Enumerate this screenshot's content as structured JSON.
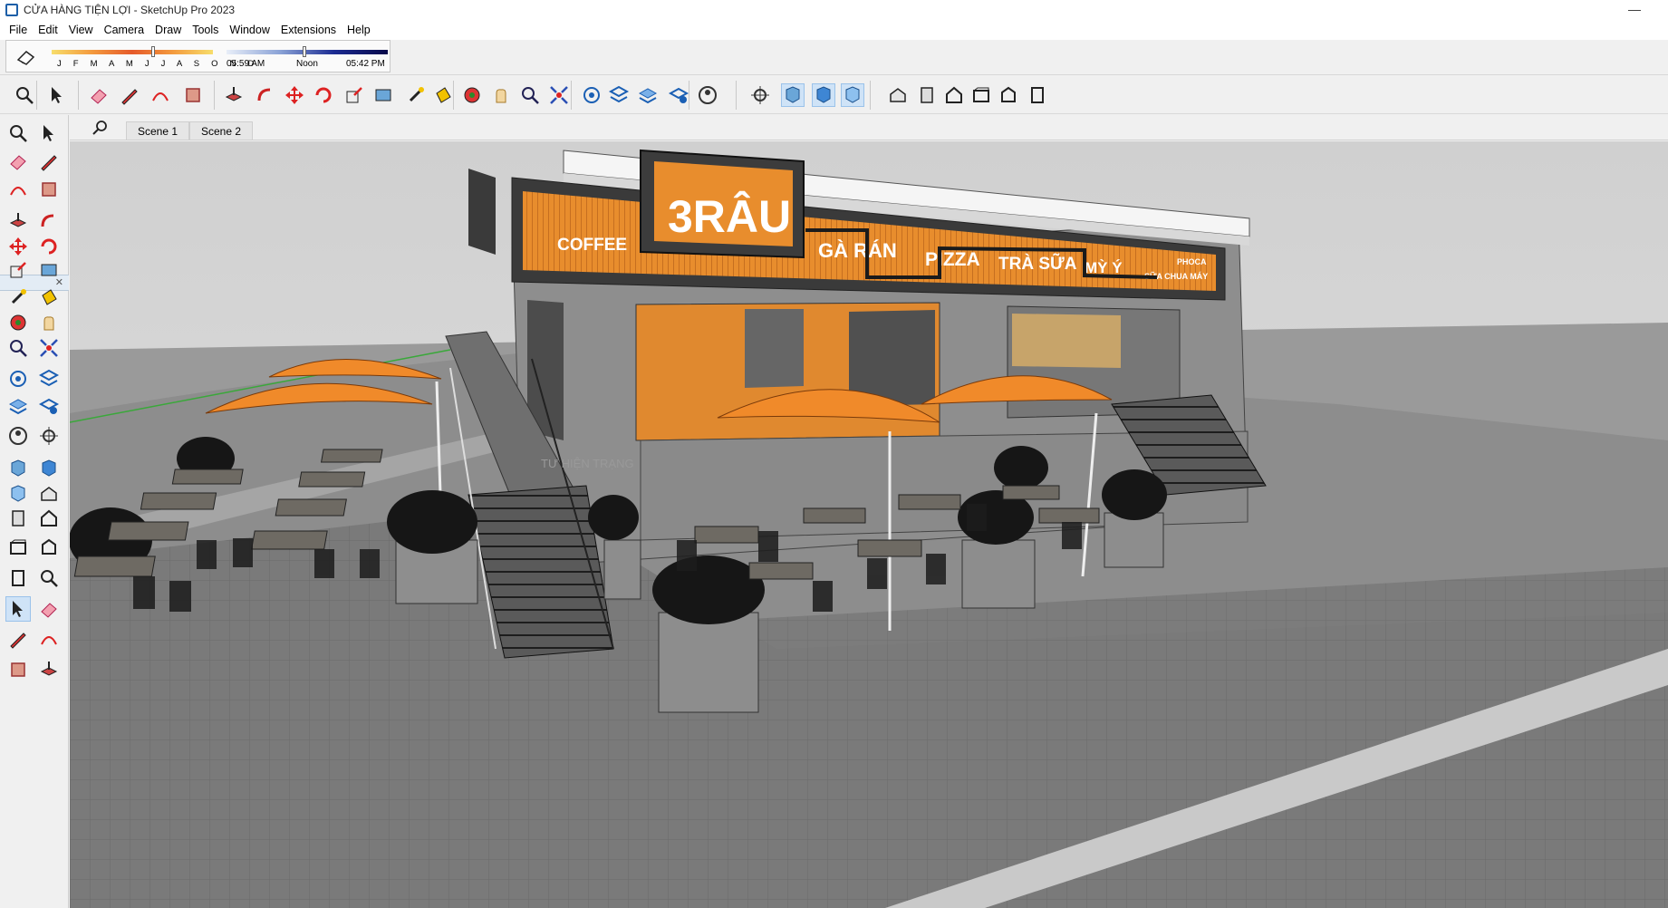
{
  "window": {
    "title": "CỬA HÀNG TIỆN LỢI - SketchUp Pro 2023",
    "minimize_glyph": "—"
  },
  "menu": [
    "File",
    "Edit",
    "View",
    "Camera",
    "Draw",
    "Tools",
    "Window",
    "Extensions",
    "Help"
  ],
  "shadows": {
    "months": "J F M A M J J A S O N D",
    "time_start": "05:59 AM",
    "time_noon": "Noon",
    "time_end": "05:42 PM",
    "month_level": 0.62,
    "time_level": 0.47
  },
  "scenes": [
    "Scene 1",
    "Scene 2"
  ],
  "toolbar_icons": [
    "zoom-icon",
    "select-icon",
    "eraser-icon",
    "pencil-icon",
    "arc-icon",
    "rectangle-icon",
    "push-pull-icon",
    "follow-me-icon",
    "move-icon",
    "rotate-icon",
    "scale-icon",
    "offset-icon",
    "tape-measure-icon",
    "paint-bucket-icon",
    "orbit-icon",
    "pan-icon",
    "zoom-window-icon",
    "zoom-extents-icon",
    "3d-warehouse-icon",
    "extension-warehouse-icon",
    "layout-icon",
    "extension-manager-icon",
    "account-icon",
    "section-plane-icon",
    "display-section-planes-icon",
    "display-section-cuts-icon",
    "display-section-fill-icon",
    "iso-view-icon",
    "top-view-icon",
    "front-view-icon",
    "right-view-icon",
    "back-view-icon",
    "left-view-icon"
  ],
  "left_icons": [
    "select-icon",
    "orbit-icon",
    "paint-bucket-icon",
    "eraser-icon",
    "component-icon",
    "tape-measure-icon",
    "line-icon",
    "freehand-icon",
    "rectangle-icon",
    "rotated-rectangle-icon",
    "arc-icon",
    "2-point-arc-icon",
    "3-point-arc-icon",
    "pie-icon",
    "move-icon",
    "push-pull-icon",
    "rotate-icon",
    "follow-me-icon",
    "scale-icon",
    "offset-icon",
    "axes-icon",
    "3d-text-icon",
    "tape-icon",
    "dimension-icon",
    "protractor-icon",
    "text-icon",
    "position-camera-icon",
    "walk-icon",
    "orbit-icon-2",
    "pan-icon",
    "zoom-icon",
    "zoom-window-icon",
    "zoom-extents-icon",
    "previous-icon",
    "look-around-icon",
    "section-plane-icon",
    "warehouse-icon",
    "extension-warehouse-icon",
    "layout-icon",
    "extension-manager-icon"
  ],
  "scene": {
    "sign_logo": "3RÂU",
    "sign_coffee": "COFFEE",
    "sign_items": [
      "GÀ RÁN",
      "PIZZA",
      "TRÀ SỮA",
      "MỲ Ý"
    ],
    "small_sign_1": "PHOCA",
    "small_sign_2": "SỮA CHUA MÁY",
    "ghost_text": "TƯ HIỆN TRẠNG",
    "colors": {
      "orange": "#e58a2e",
      "sign_dark": "#2e2e2e",
      "wall": "#8e8e8e",
      "umbrella": "#f08a2a",
      "sky": "#dadada",
      "ground": "#7c7c7c"
    }
  }
}
